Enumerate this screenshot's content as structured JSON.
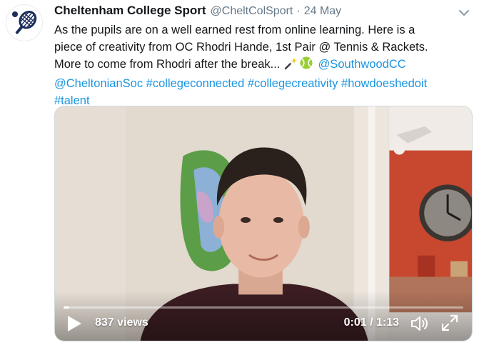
{
  "tweet": {
    "name": "Cheltenham College Sport",
    "handle": "@CheltColSport",
    "separator": "·",
    "date": "24 May",
    "lines": {
      "l1": "As the pupils are on a well earned rest from online learning. Here is a",
      "l2": "piece of creativity from OC Rhodri Hande, 1st Pair @ Tennis & Rackets.",
      "l3_text": "More to come from Rhodri after the break... ",
      "l3_mention": "@SouthwoodCC",
      "l4_mention": "@CheltonianSoc",
      "l4_tags": [
        "#collegeconnected",
        "#collegecreativity",
        "#howdoeshedoit"
      ],
      "l5_tag": "#talent"
    },
    "emoji": [
      "magic-wand-icon",
      "tennis-ball-icon"
    ]
  },
  "video": {
    "views": "837 views",
    "current_time": "0:01",
    "time_sep": " / ",
    "duration": "1:13",
    "progress": 0.014
  },
  "colors": {
    "link": "#1b95e0",
    "text": "#14171a",
    "muted": "#657786",
    "avatar_icon": "#1c2e5c"
  }
}
